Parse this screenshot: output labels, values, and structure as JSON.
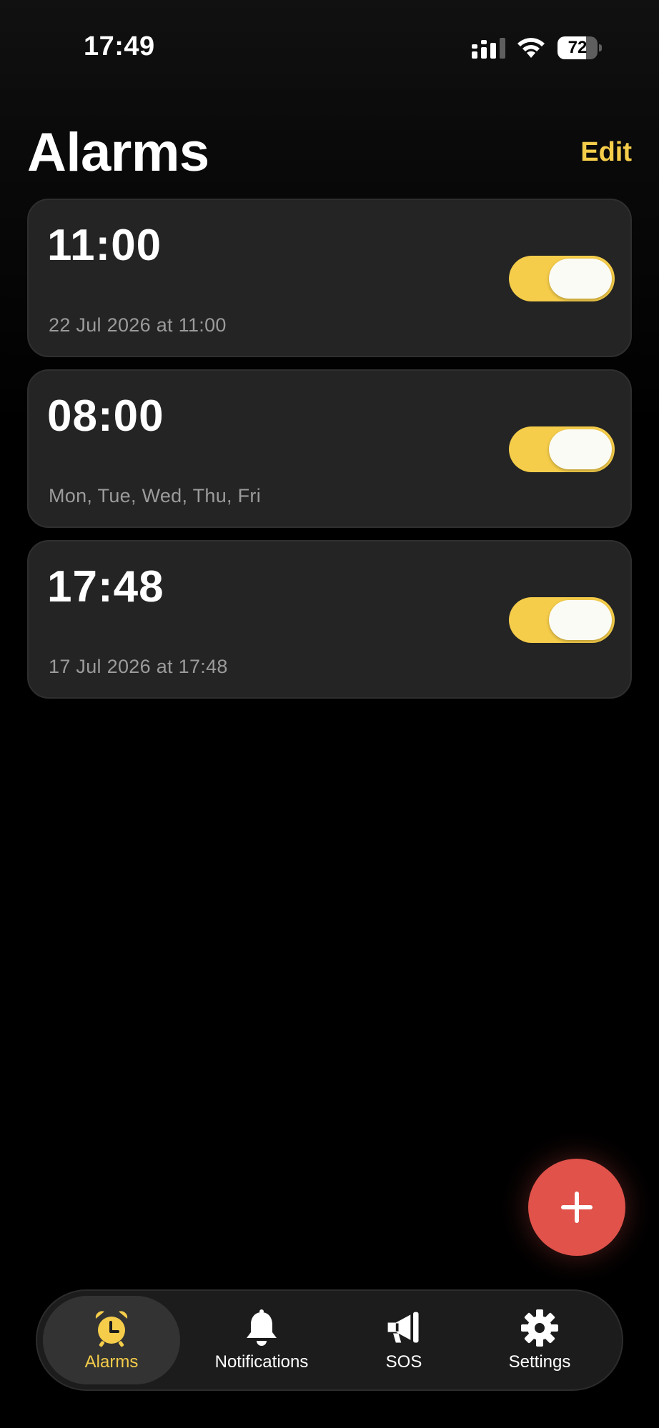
{
  "status_bar": {
    "time": "17:49",
    "battery_level": "72",
    "battery_fraction": 0.72
  },
  "header": {
    "title": "Alarms",
    "edit_label": "Edit"
  },
  "alarms": [
    {
      "time": "11:00",
      "subtitle": "22 Jul 2026 at 11:00",
      "enabled": true
    },
    {
      "time": "08:00",
      "subtitle": "Mon, Tue, Wed, Thu, Fri",
      "enabled": true
    },
    {
      "time": "17:48",
      "subtitle": "17 Jul 2026 at 17:48",
      "enabled": true
    }
  ],
  "fab": {
    "icon": "plus-icon"
  },
  "tab_bar": {
    "tabs": [
      {
        "label": "Alarms",
        "icon": "alarm-clock-icon",
        "active": true
      },
      {
        "label": "Notifications",
        "icon": "bell-icon",
        "active": false
      },
      {
        "label": "SOS",
        "icon": "megaphone-icon",
        "active": false
      },
      {
        "label": "Settings",
        "icon": "gear-icon",
        "active": false
      }
    ]
  },
  "colors": {
    "accent": "#f5cd4a",
    "fab": "#e0524a",
    "card": "#242424",
    "background": "#000000"
  }
}
